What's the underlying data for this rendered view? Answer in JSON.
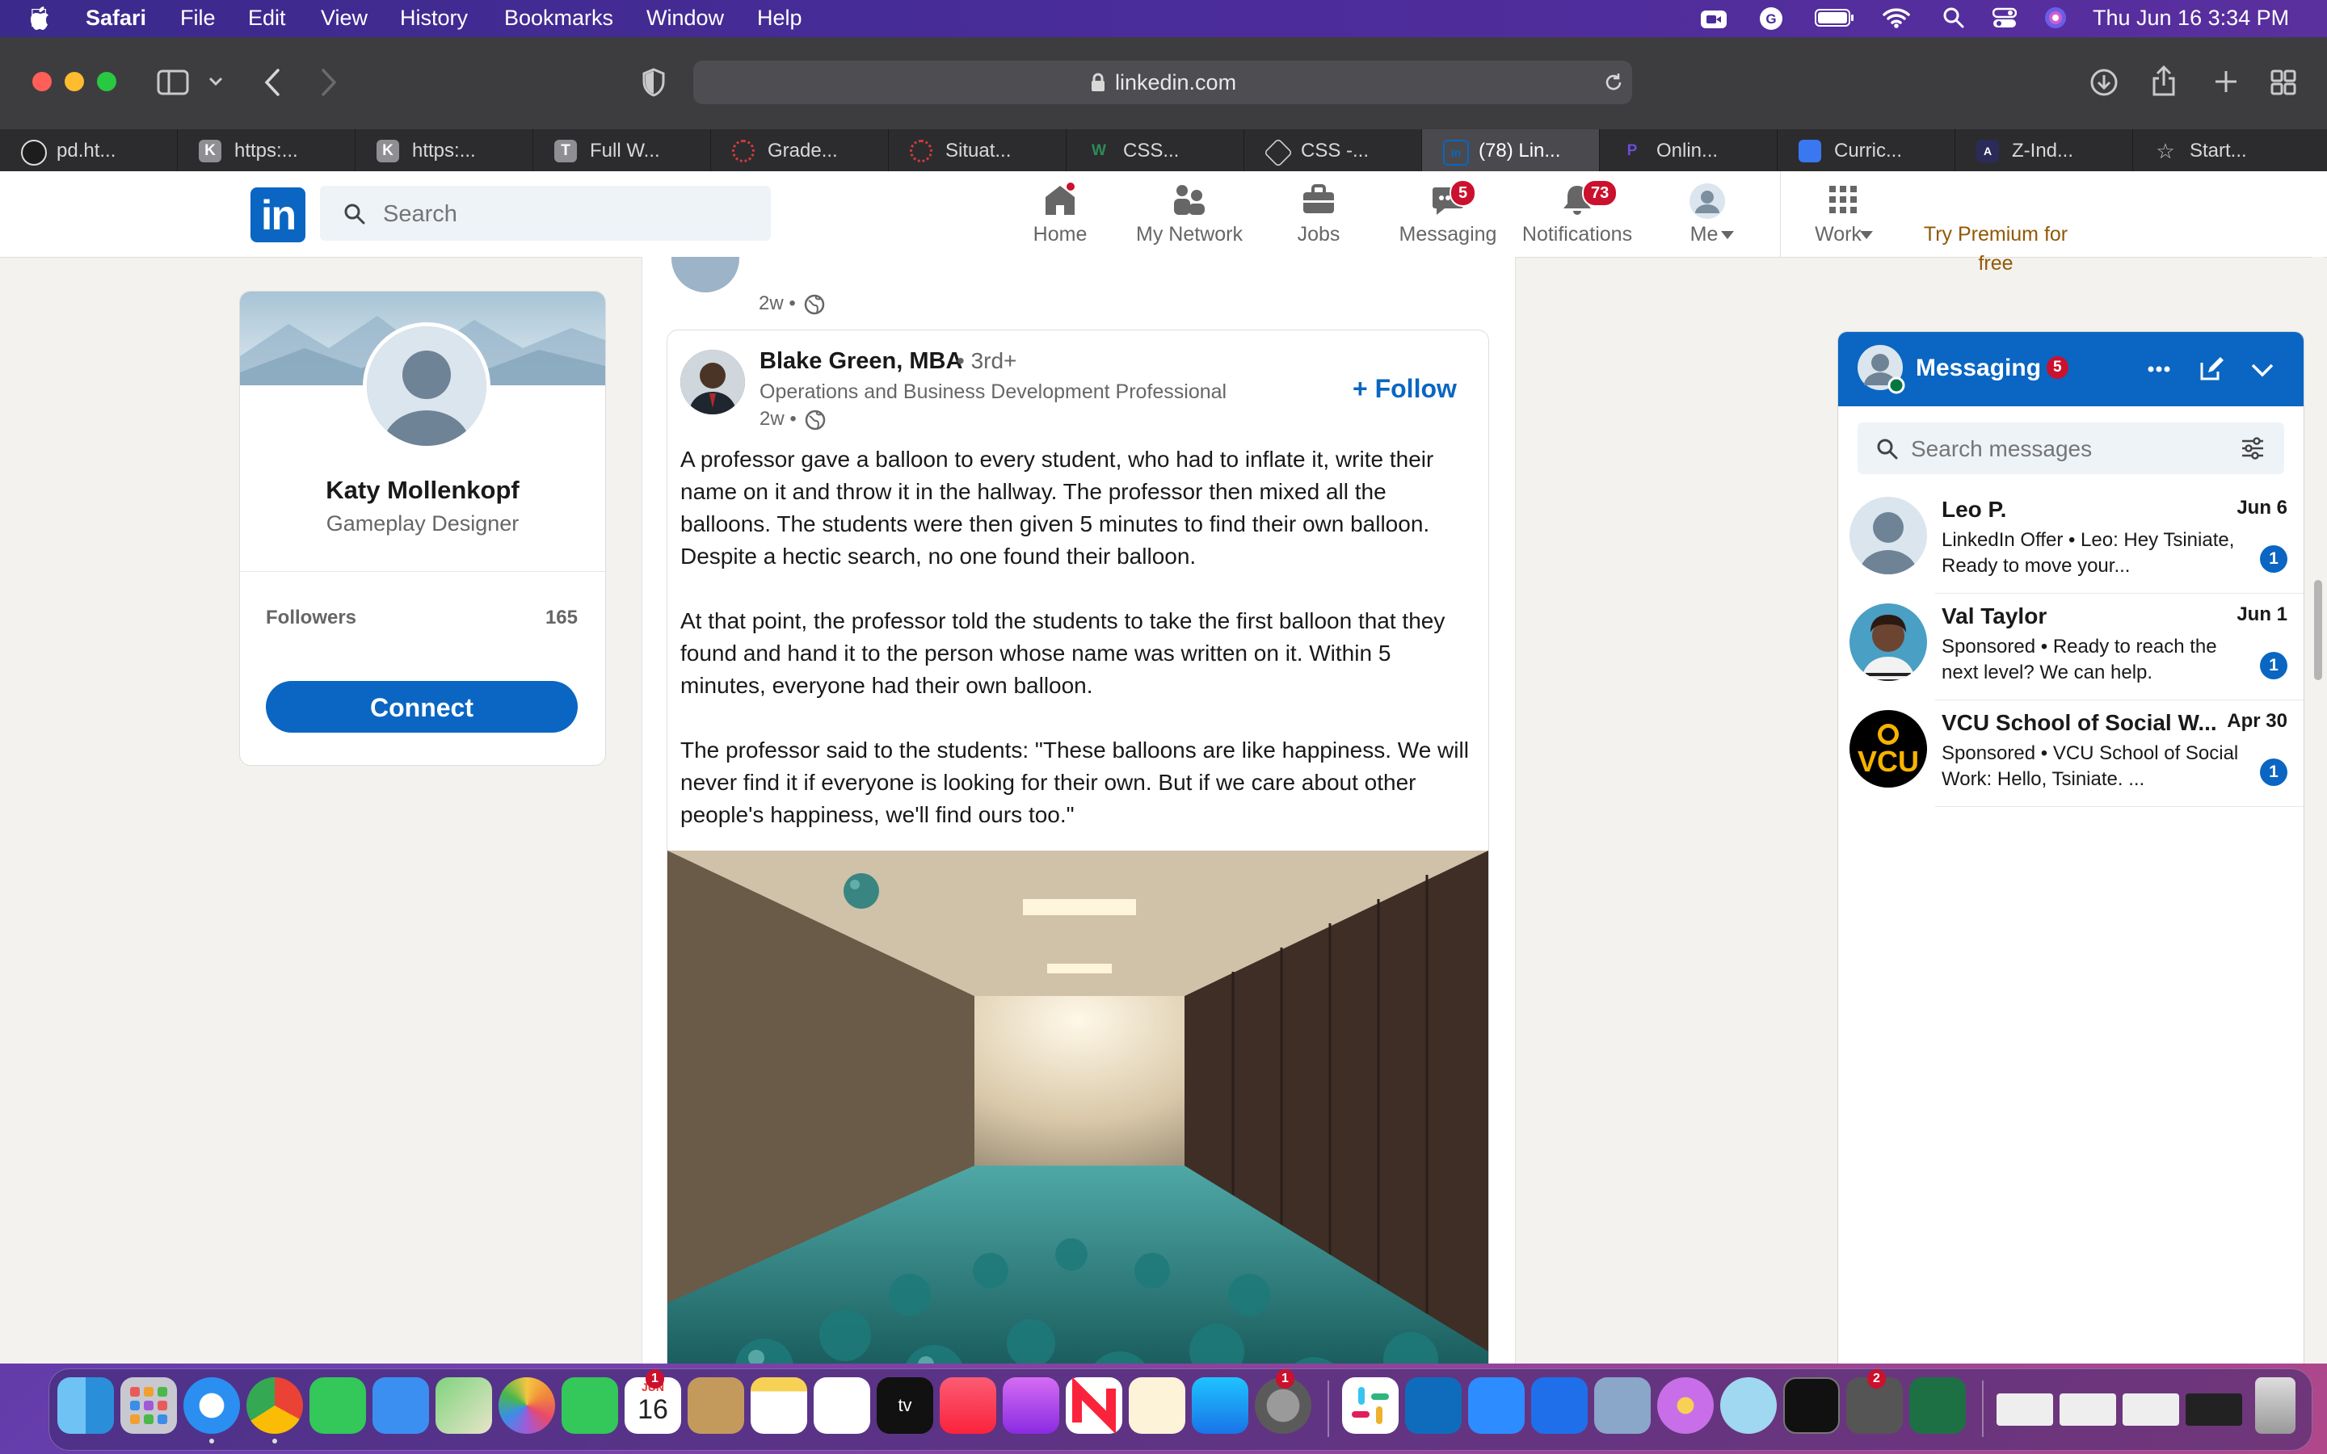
{
  "menubar": {
    "app_name": "Safari",
    "menus": [
      "File",
      "Edit",
      "View",
      "History",
      "Bookmarks",
      "Window",
      "Help"
    ],
    "clock": "Thu Jun 16  3:34 PM"
  },
  "browser": {
    "url": "linkedin.com",
    "tabs": [
      {
        "label": "pd.ht...",
        "fav_text": "",
        "fav_color": "#1d1d1d"
      },
      {
        "label": "https:...",
        "fav_text": "K",
        "fav_color": "#8e8e93"
      },
      {
        "label": "https:...",
        "fav_text": "K",
        "fav_color": "#8e8e93"
      },
      {
        "label": "Full W...",
        "fav_text": "T",
        "fav_color": "#8e8e93"
      },
      {
        "label": "Grade...",
        "fav_text": "",
        "fav_color": "#d43b3b"
      },
      {
        "label": "Situat...",
        "fav_text": "",
        "fav_color": "#d43b3b"
      },
      {
        "label": "CSS...",
        "fav_text": "W",
        "fav_color": "#2e8b57"
      },
      {
        "label": "CSS -...",
        "fav_text": "",
        "fav_color": "#cfcfcf"
      },
      {
        "label": "(78) Lin...",
        "fav_text": "in",
        "fav_color": "#0a66c2"
      },
      {
        "label": "Onlin...",
        "fav_text": "P",
        "fav_color": "#6c4bd8"
      },
      {
        "label": "Curric...",
        "fav_text": "",
        "fav_color": "#3a78f2"
      },
      {
        "label": "Z-Ind...",
        "fav_text": "A",
        "fav_color": "#2b2b5a"
      },
      {
        "label": "Start...",
        "fav_text": "☆",
        "fav_color": "#2c2c2e"
      }
    ]
  },
  "linkedin": {
    "search_placeholder": "Search",
    "nav": {
      "home": {
        "label": "Home"
      },
      "network": {
        "label": "My Network"
      },
      "jobs": {
        "label": "Jobs"
      },
      "messaging": {
        "label": "Messaging",
        "badge": "5"
      },
      "notifications": {
        "label": "Notifications",
        "badge": "73"
      },
      "me": {
        "label": "Me"
      },
      "work": {
        "label": "Work"
      },
      "premium": "Try Premium for free"
    },
    "profile": {
      "name": "Katy Mollenkopf",
      "title": "Gameplay Designer",
      "followers_label": "Followers",
      "followers_count": "165",
      "connect_label": "Connect"
    },
    "prev_post_time": "2w •",
    "post": {
      "author": "Blake Green, MBA",
      "degree": "• 3rd+",
      "headline": "Operations and Business Development Professional",
      "time": "2w •",
      "follow_label": "+ Follow",
      "paragraphs": [
        "A professor gave a balloon to every student, who had to inflate it, write their name on it and throw it in the hallway. The professor then mixed all the balloons. The students were then given 5 minutes to find their own balloon. Despite a hectic search, no one found their balloon.",
        "At that point, the professor told the students to take the first balloon that they found and hand it to the person whose name was written on it. Within 5 minutes, everyone had their own balloon.",
        "The professor said to the students: \"These balloons are like happiness. We will never find it if everyone is looking for their own. But if we care about other people's happiness, we'll find ours too.\""
      ]
    },
    "messaging": {
      "title": "Messaging",
      "badge": "5",
      "search_placeholder": "Search messages",
      "conversations": [
        {
          "name": "Leo P.",
          "date": "Jun 6",
          "preview": "LinkedIn Offer •  Leo: Hey Tsiniate, Ready to move your...",
          "unread": "1"
        },
        {
          "name": "Val Taylor",
          "date": "Jun 1",
          "preview": "Sponsored •  Ready to reach the next level? We can help.",
          "unread": "1"
        },
        {
          "name": "VCU School of Social W...",
          "date": "Apr 30",
          "preview": "Sponsored •  VCU School of Social Work: Hello, Tsiniate. ...",
          "unread": "1"
        }
      ]
    }
  },
  "dock": {
    "calendar_month": "JUN",
    "calendar_day": "16",
    "calendar_badge": "1",
    "settings_badge": "1",
    "app_badge": "2"
  }
}
